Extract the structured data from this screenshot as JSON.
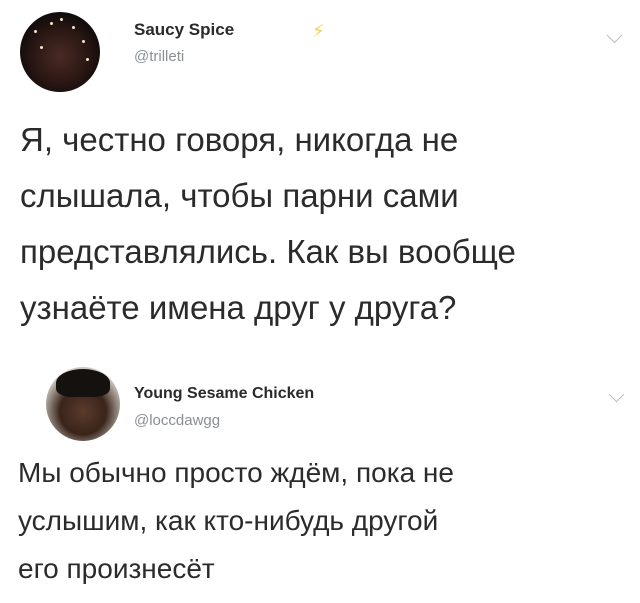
{
  "tweets": [
    {
      "display_name": "Saucy Spice",
      "handle": "@trilleti",
      "badge_icon": "lightning-bolt-icon",
      "badge_glyph": "⚡",
      "text_lines": [
        "Я, честно говоря, никогда не",
        "слышала, чтобы парни сами",
        "представлялись. Как вы вообще",
        "узнаёте имена друг у друга?"
      ]
    },
    {
      "display_name": "Young Sesame Chicken",
      "handle": "@loccdawgg",
      "text_lines": [
        "Мы обычно просто ждём, пока не",
        "услышим, как кто-нибудь другой",
        "его произнесёт"
      ]
    }
  ],
  "colors": {
    "badge": "#f2d14d",
    "handle": "#8a8f94",
    "text": "#2b2b2b"
  }
}
